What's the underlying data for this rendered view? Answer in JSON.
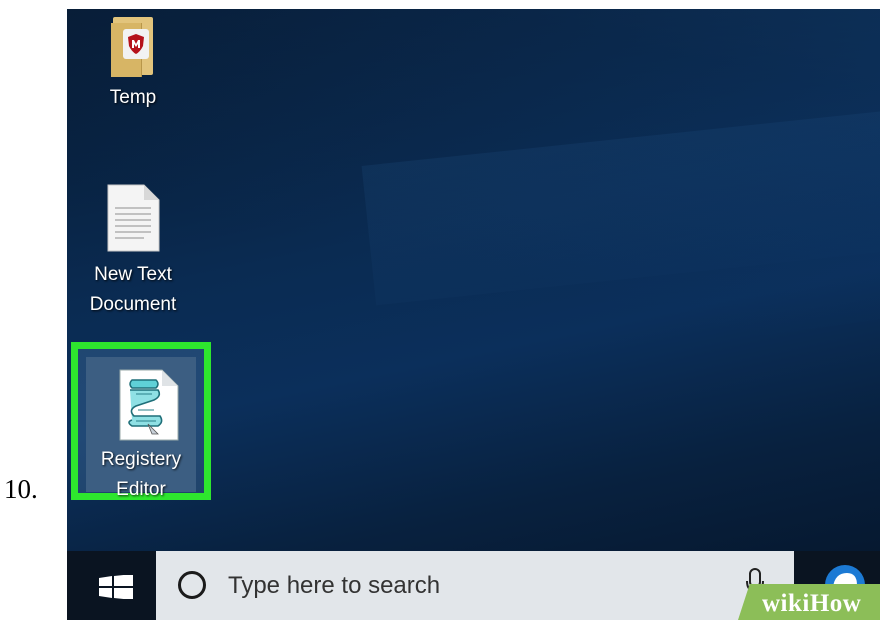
{
  "step": {
    "number": "10."
  },
  "desktop": {
    "icons": [
      {
        "label": "Temp",
        "icon": "folder-shield-icon",
        "selected": false
      },
      {
        "label": "New Text\nDocument",
        "icon": "text-document-icon",
        "selected": false
      },
      {
        "label": "Registery\nEditor",
        "icon": "registry-editor-icon",
        "selected": true
      }
    ],
    "highlight_color": "#2ee62e"
  },
  "taskbar": {
    "start_icon": "windows-logo-icon",
    "search": {
      "placeholder": "Type here to search",
      "value": ""
    },
    "mic_icon": "microphone-icon",
    "edge_icon": "edge-browser-icon"
  },
  "watermark": {
    "part1": "wiki",
    "part2": "How",
    "color": "#8cbe58"
  }
}
